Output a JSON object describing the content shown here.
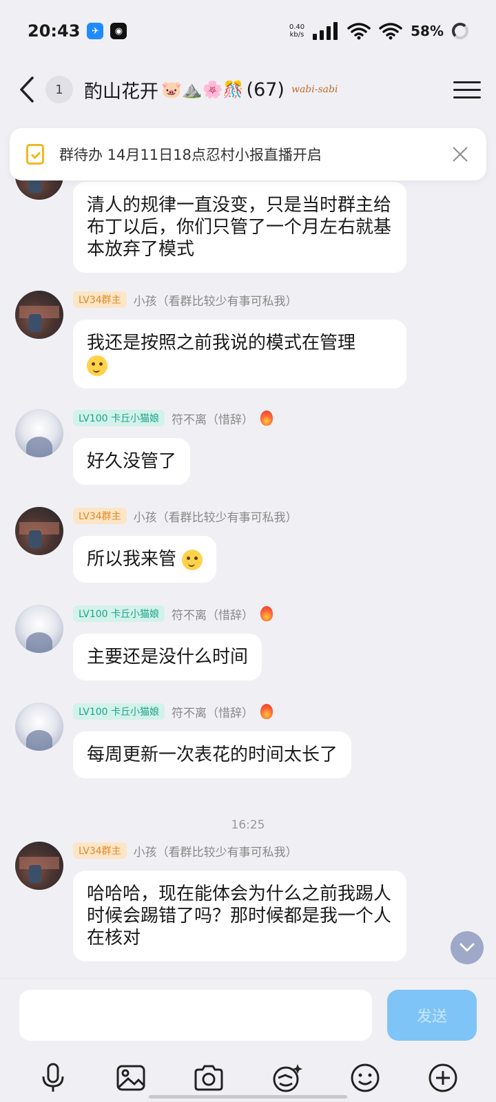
{
  "status_bar": {
    "time": "20:43",
    "net_speed_value": "0.40",
    "net_speed_unit": "kb/s",
    "battery": "58%"
  },
  "header": {
    "unread_count": "1",
    "group_name": "酌山花开",
    "title_emojis": "🐷⛰️🌸🎊",
    "member_count": "(67)",
    "tag": "wabi-sabi"
  },
  "todo": {
    "text": "群待办 14月11日18点忍村小报直播开启"
  },
  "messages": [
    {
      "type": "text",
      "avatar": "dark",
      "text": "清人的规律一直没变，只是当时群主给布丁以后，你们只管了一个月左右就基本放弃了模式"
    },
    {
      "type": "text",
      "avatar": "dark",
      "level": "LV34群主",
      "nick": "小孩（看群比较少有事可私我）",
      "text": "我还是按照之前我说的模式在管理"
    },
    {
      "type": "text",
      "avatar": "light",
      "level": "LV100 卡丘小猫娘",
      "nick": "符不离（惜辞）",
      "text": "好久没管了"
    },
    {
      "type": "text",
      "avatar": "dark",
      "level": "LV34群主",
      "nick": "小孩（看群比较少有事可私我）",
      "text": "所以我来管"
    },
    {
      "type": "text",
      "avatar": "light",
      "level": "LV100 卡丘小猫娘",
      "nick": "符不离（惜辞）",
      "text": "主要还是没什么时间"
    },
    {
      "type": "text",
      "avatar": "light",
      "level": "LV100 卡丘小猫娘",
      "nick": "符不离（惜辞）",
      "text": "每周更新一次表花的时间太长了"
    },
    {
      "type": "time",
      "text": "16:25"
    },
    {
      "type": "text",
      "avatar": "dark",
      "level": "LV34群主",
      "nick": "小孩（看群比较少有事可私我）",
      "text": "哈哈哈，现在能体会为什么之前我踢人时候会踢错了吗？那时候都是我一个人在核对"
    }
  ],
  "input": {
    "placeholder": "",
    "send_label": "发送"
  },
  "toolbar": {
    "icons": [
      "microphone-icon",
      "image-icon",
      "camera-icon",
      "sticker-icon",
      "emoji-icon",
      "plus-icon"
    ]
  }
}
